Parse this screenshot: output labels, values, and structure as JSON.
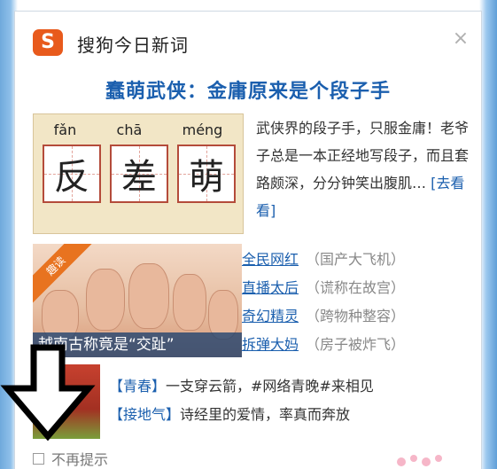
{
  "app": {
    "title": "搜狗今日新词",
    "logo_letter": "S"
  },
  "headline": "蠢萌武侠：金庸原来是个段子手",
  "feature": {
    "pinyin": [
      "fǎn",
      "chā",
      "méng"
    ],
    "chars": [
      "反",
      "差",
      "萌"
    ]
  },
  "description": {
    "text": "武侠界的段子手，只服金庸！老爷子总是一本正经地写段子，而且套路颇深，分分钟笑出腹肌…",
    "link": "[去看看]"
  },
  "photo": {
    "ribbon": "趣读",
    "caption": "越南古称竟是“交趾”"
  },
  "topics": [
    {
      "term": "全民网红",
      "note": "（国产大飞机）"
    },
    {
      "term": "直播太后",
      "note": "（谎称在故宫）"
    },
    {
      "term": "奇幻精灵",
      "note": "（跨物种整容）"
    },
    {
      "term": "拆弹大妈",
      "note": "（房子被炸飞）"
    }
  ],
  "news": [
    {
      "tag": "【青春】",
      "text": "一支穿云箭，#网络青晚#来相见"
    },
    {
      "tag": "【接地气】",
      "text": "诗经里的爱情，率真而奔放"
    }
  ],
  "footer": {
    "no_remind": "不再提示"
  },
  "close_glyph": "×",
  "colors": {
    "accent": "#1b5fae",
    "logo": "#e85a1c",
    "ribbon": "#e8731f"
  }
}
